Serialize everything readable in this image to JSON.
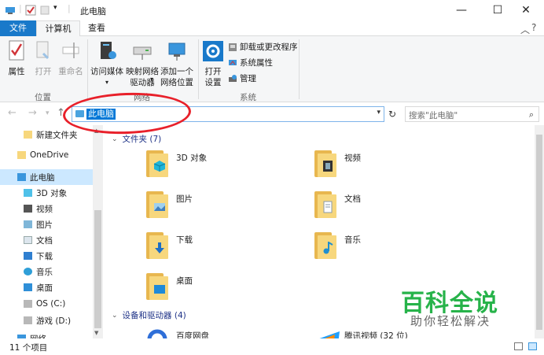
{
  "window": {
    "title": "此电脑",
    "controls": {
      "minimize": "—",
      "maximize": "☐",
      "close": "✕"
    }
  },
  "ribbon_tabs": [
    {
      "label": "文件"
    },
    {
      "label": "计算机"
    },
    {
      "label": "查看"
    }
  ],
  "ribbon": {
    "location_group": {
      "label": "位置",
      "buttons": [
        {
          "label": "属性",
          "enabled": true
        },
        {
          "label": "打开",
          "enabled": false
        },
        {
          "label": "重命名",
          "enabled": false
        }
      ]
    },
    "network_group": {
      "label": "网络",
      "buttons": [
        {
          "line1": "访问媒体",
          "line2": ""
        },
        {
          "line1": "映射网络",
          "line2": "驱动器"
        },
        {
          "line1": "添加一个",
          "line2": "网络位置"
        }
      ]
    },
    "system_group": {
      "label": "系统",
      "open_settings": {
        "line1": "打开",
        "line2": "设置"
      },
      "items": [
        {
          "label": "卸载或更改程序"
        },
        {
          "label": "系统属性"
        },
        {
          "label": "管理"
        }
      ]
    }
  },
  "address_bar": {
    "path": "此电脑",
    "search_placeholder": "搜索\"此电脑\""
  },
  "sidebar": {
    "items": [
      {
        "label": "新建文件夹",
        "level": 1,
        "selected": false
      },
      {
        "label": "OneDrive",
        "level": 0,
        "selected": false
      },
      {
        "label": "此电脑",
        "level": 0,
        "selected": true
      },
      {
        "label": "3D 对象",
        "level": 1,
        "selected": false
      },
      {
        "label": "视频",
        "level": 1,
        "selected": false
      },
      {
        "label": "图片",
        "level": 1,
        "selected": false
      },
      {
        "label": "文档",
        "level": 1,
        "selected": false
      },
      {
        "label": "下载",
        "level": 1,
        "selected": false
      },
      {
        "label": "音乐",
        "level": 1,
        "selected": false
      },
      {
        "label": "桌面",
        "level": 1,
        "selected": false
      },
      {
        "label": "OS (C:)",
        "level": 1,
        "selected": false
      },
      {
        "label": "游戏 (D:)",
        "level": 1,
        "selected": false
      },
      {
        "label": "网络",
        "level": 0,
        "selected": false
      }
    ]
  },
  "content": {
    "folders_header": "文件夹 (7)",
    "folders": [
      {
        "name": "3D 对象",
        "badge": "cube"
      },
      {
        "name": "视频",
        "badge": "film"
      },
      {
        "name": "图片",
        "badge": "picture"
      },
      {
        "name": "文档",
        "badge": "document"
      },
      {
        "name": "下载",
        "badge": "download"
      },
      {
        "name": "音乐",
        "badge": "music"
      },
      {
        "name": "桌面",
        "badge": "desktop"
      }
    ],
    "devices_header": "设备和驱动器 (4)",
    "devices": [
      {
        "name": "百度网盘"
      },
      {
        "name": "腾讯视频 (32 位)"
      }
    ]
  },
  "status": {
    "count": "11 个项目"
  },
  "watermark": {
    "title": "百科全说",
    "subtitle": "助你轻松解决"
  },
  "colors": {
    "accent": "#1979ca",
    "selection": "#cce8ff",
    "annotation": "#e8202a",
    "watermark": "#27b34a"
  }
}
